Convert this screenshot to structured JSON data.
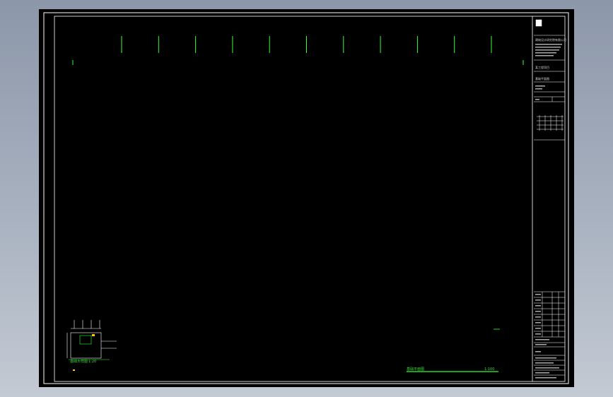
{
  "app": {
    "viewport_background": "#000000",
    "canvas_background": "#aab3c1"
  },
  "drawing": {
    "line_color": "#ffffff",
    "accent_color": "#33ff33",
    "marker_color": "#ffcc00",
    "column_markers": 11,
    "bottom_title": "基础平面图",
    "bottom_scale": "1:100",
    "detail_title": "基础大样图",
    "detail_scale": "1:20"
  },
  "title_block": {
    "company": "建筑设计研究院有限公司",
    "project": "某工程项目",
    "drawing_name": "基础平面图"
  }
}
